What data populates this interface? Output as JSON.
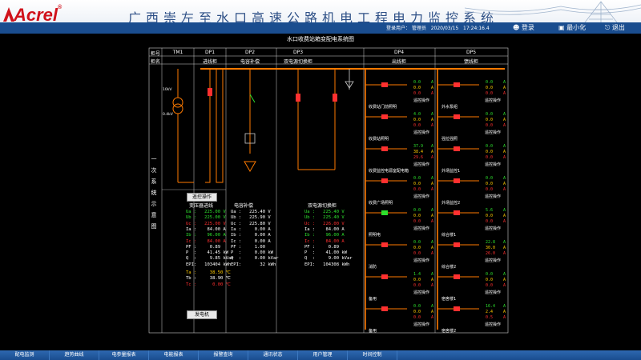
{
  "header": {
    "logo": "Acrel",
    "logo_reg": "®",
    "title": "广西崇左至水口高速公路机电工程电力监控系统",
    "user_label": "登录用户：",
    "user": "管理员",
    "date": "2020/03/15",
    "time": "17:24:16.4",
    "login": "登录",
    "minimize": "最小化",
    "exit": "退出"
  },
  "diagram": {
    "title": "水口收费站箱变配电系统图",
    "row_labels": {
      "num": "柜号",
      "name": "柜名"
    },
    "side_label": [
      "一",
      "次",
      "系",
      "统",
      "示",
      "意",
      "图"
    ],
    "panels": [
      {
        "num": "TM1",
        "name": ""
      },
      {
        "num": "DP1",
        "name": "进线柜"
      },
      {
        "num": "DP2",
        "name": "电容补偿"
      },
      {
        "num": "DP3",
        "name": "双电源切换柜"
      },
      {
        "num": "DP4",
        "name": "出线柜"
      },
      {
        "num": "DP5",
        "name": "馈线柜"
      }
    ],
    "transformer": {
      "hv": "10kV",
      "lv": "0.4kV"
    },
    "btn_remote": "遥控操作",
    "btn_gen": "发电机",
    "blocks": [
      {
        "title": "变压器进线",
        "lines": [
          {
            "t": "Ua :   225.00 V",
            "c": "#2ee02e"
          },
          {
            "t": "Ub :   225.00 V",
            "c": "#2ee02e"
          },
          {
            "t": "Uc :   225.00 V",
            "c": "#ff3030"
          },
          {
            "t": "Ia :    84.00 A",
            "c": "#ffffff"
          },
          {
            "t": "Ib :    96.00 A",
            "c": "#2ee02e"
          },
          {
            "t": "Ic :    84.00 A",
            "c": "#ff3030"
          },
          {
            "t": "PF :     0.89",
            "c": "#ffffff"
          },
          {
            "t": "P  :    41.45 kW",
            "c": "#ffffff"
          },
          {
            "t": "Q  :     9.85 kVar",
            "c": "#ffffff"
          },
          {
            "t": "EPI:   103404 kWh",
            "c": "#ffffff"
          }
        ]
      },
      {
        "title": "电容补偿",
        "lines": [
          {
            "t": "Ua :   225.40 V",
            "c": "#ffffff"
          },
          {
            "t": "Ub :   225.90 V",
            "c": "#ffffff"
          },
          {
            "t": "Uc :   225.80 V",
            "c": "#ffffff"
          },
          {
            "t": "Ia :     0.00 A",
            "c": "#ffffff"
          },
          {
            "t": "Ib :     0.00 A",
            "c": "#ffffff"
          },
          {
            "t": "Ic :     0.00 A",
            "c": "#ffffff"
          },
          {
            "t": "PF :     1.00",
            "c": "#ffffff"
          },
          {
            "t": "P  :     0.00 kW",
            "c": "#ffffff"
          },
          {
            "t": "Q  :     0.00 kVar",
            "c": "#ffffff"
          },
          {
            "t": "EPI:       32 kWh",
            "c": "#ffffff"
          }
        ]
      },
      {
        "title": "双电源切换柜",
        "lines": [
          {
            "t": "Ua :   225.40 V",
            "c": "#2ee02e"
          },
          {
            "t": "Ub :   225.40 V",
            "c": "#2ee02e"
          },
          {
            "t": "Uc :   226.00 V",
            "c": "#ff3030"
          },
          {
            "t": "Ia :    84.00 A",
            "c": "#ffffff"
          },
          {
            "t": "Ib :    96.00 A",
            "c": "#2ee02e"
          },
          {
            "t": "Ic :    84.00 A",
            "c": "#ff3030"
          },
          {
            "t": "PF :     0.89",
            "c": "#ffffff"
          },
          {
            "t": "P  :    41.00 kW",
            "c": "#ffffff"
          },
          {
            "t": "Q  :     9.00 kVar",
            "c": "#ffffff"
          },
          {
            "t": "EPI:   104308 kWh",
            "c": "#ffffff"
          }
        ]
      }
    ],
    "temps": [
      {
        "t": "Ta :     38.50 ℃",
        "c": "#ffcc00"
      },
      {
        "t": "Tb :     38.90 ℃",
        "c": "#ffffff"
      },
      {
        "t": "Tc :      0.00 ℃",
        "c": "#ff3030"
      }
    ],
    "dp4": [
      {
        "label": "收费站门前照明",
        "a": "0.0",
        "b": "0.0",
        "c": "0.0"
      },
      {
        "label": "收费站照明",
        "a": "4.0",
        "b": "0.0",
        "c": "0.0"
      },
      {
        "label": "收费监控电源室配电箱",
        "a": "37.9",
        "b": "38.4",
        "c": "29.6"
      },
      {
        "label": "收费广场照明",
        "a": "0.0",
        "b": "0.0",
        "c": "0.0"
      },
      {
        "label": "照明电",
        "a": "0.0",
        "b": "0.0",
        "c": "0.0"
      },
      {
        "label": "消防",
        "a": "0.0",
        "b": "0.0",
        "c": "0.0"
      },
      {
        "label": "备用",
        "a": "1.4",
        "b": "0.0",
        "c": "0.0"
      },
      {
        "label": "备用",
        "a": "0.0",
        "b": "0.0",
        "c": "0.0"
      }
    ],
    "dp5": [
      {
        "label": "外水泵组",
        "a": "0.0",
        "b": "0.0",
        "c": "0.0"
      },
      {
        "label": "强拉强照",
        "a": "0.0",
        "b": "0.0",
        "c": "0.0"
      },
      {
        "label": "外场监控1",
        "a": "0.0",
        "b": "0.0",
        "c": "0.0"
      },
      {
        "label": "外场监控2",
        "a": "0.0",
        "b": "0.0",
        "c": "0.0"
      },
      {
        "label": "综合楼1",
        "a": "5.6",
        "b": "0.0",
        "c": "0.0"
      },
      {
        "label": "综合楼2",
        "a": "22.8",
        "b": "30.0",
        "c": "26.0"
      },
      {
        "label": "宿舍楼1",
        "a": "0.0",
        "b": "0.0",
        "c": "0.0"
      },
      {
        "label": "宿舍楼2",
        "a": "16.4",
        "b": "2.4",
        "c": "0.5"
      }
    ],
    "unit_a": "A",
    "ctrl_label": "遥控操作"
  },
  "footer": {
    "tabs": [
      "配电监测",
      "趋势曲线",
      "电参量报表",
      "电能报表",
      "报警查询",
      "通讯状态",
      "用户管理",
      "时间控制"
    ]
  },
  "colors": {
    "bus": "#ff7a00",
    "line": "#ff7a00",
    "on": "#ff3030",
    "off": "#2ee02e",
    "frame": "#cfcfcf"
  }
}
